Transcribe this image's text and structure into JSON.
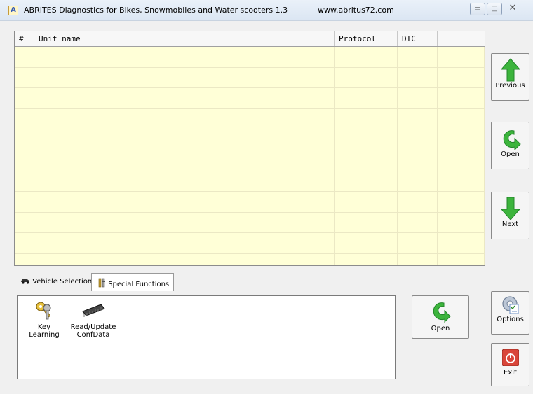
{
  "window": {
    "title": "ABRITES Diagnostics for Bikes, Snowmobiles and Water scooters 1.3",
    "url": "www.abritus72.com",
    "app_icon_letter": "A",
    "minimize_glyph": "▭",
    "maximize_glyph": "□",
    "close_glyph": "✕"
  },
  "grid": {
    "columns": [
      "#",
      "Unit name",
      "Protocol",
      "DTC",
      ""
    ],
    "rows": 11,
    "background": "#ffffd7"
  },
  "side_buttons": {
    "previous": "Previous",
    "open": "Open",
    "next": "Next",
    "options": "Options",
    "exit": "Exit"
  },
  "tabs": [
    {
      "label": "Vehicle Selection",
      "icon": "car-icon",
      "active": false
    },
    {
      "label": "Special Functions",
      "icon": "tools-icon",
      "active": true
    }
  ],
  "functions": [
    {
      "line1": "Key Learning",
      "line2": "",
      "icon": "keys-icon"
    },
    {
      "line1": "Read/Update",
      "line2": "ConfData",
      "icon": "chip-icon"
    }
  ],
  "panel_open": "Open",
  "colors": {
    "arrow_green": "#3cb43c",
    "exit_red": "#d9463a"
  }
}
